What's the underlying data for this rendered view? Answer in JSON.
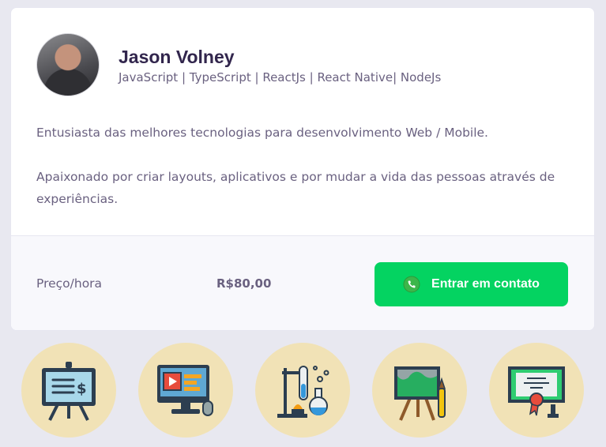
{
  "teacher": {
    "name": "Jason Volney",
    "subjects": "JavaScript | TypeScript | ReactJs | React Native| NodeJs",
    "bio_line1": "Entusiasta das melhores tecnologias para desenvolvimento Web / Mobile.",
    "bio_line2": "Apaixonado por criar layouts, aplicativos e por mudar a vida das pessoas através de experiências."
  },
  "footer": {
    "price_label": "Preço/hora",
    "price_value": "R$80,00",
    "contact_label": "Entrar em contato"
  },
  "colors": {
    "accent_green": "#04d361",
    "text_title": "#32264d",
    "text_body": "#6a6180",
    "icon_circle": "#f1e2b6"
  },
  "icons": [
    "presentation-board-icon",
    "computer-video-icon",
    "laboratory-icon",
    "painting-easel-icon",
    "certificate-icon"
  ]
}
